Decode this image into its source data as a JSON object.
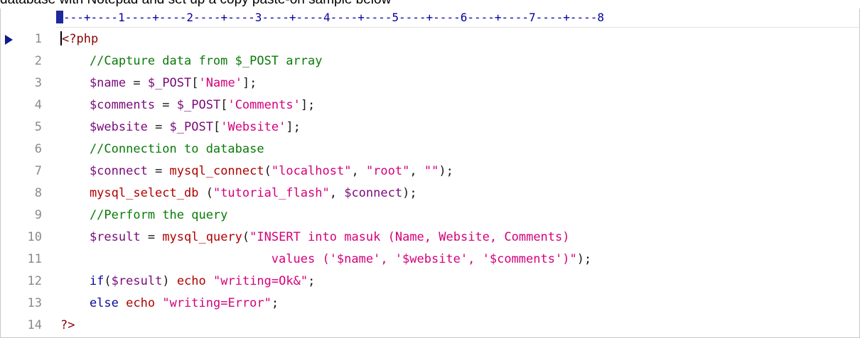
{
  "caption": "database with Notepad and set up a copy paste-on sample below",
  "ruler": "---+----1----+----2----+----3----+----4----+----5----+----6----+----7----+----8",
  "colors": {
    "comment": "#0a7a0a",
    "variable": "#7a0a7a",
    "string": "#d4007a",
    "function": "#b00000",
    "keyword": "#0a0a9a",
    "line_number": "#8a8a8a",
    "ruler": "#0000a0"
  },
  "icons": {
    "current_line": "current-line-arrow-icon"
  },
  "lines": [
    {
      "num": "1",
      "tokens": [
        {
          "t": "<?php",
          "c": "c-tag"
        }
      ]
    },
    {
      "num": "2",
      "tokens": [
        {
          "t": "    //Capture data from $_POST array",
          "c": "c-comment"
        }
      ]
    },
    {
      "num": "3",
      "tokens": [
        {
          "t": "    $name",
          "c": "c-var"
        },
        {
          "t": " = ",
          "c": ""
        },
        {
          "t": "$_POST",
          "c": "c-var"
        },
        {
          "t": "[",
          "c": ""
        },
        {
          "t": "'Name'",
          "c": "c-str"
        },
        {
          "t": "];",
          "c": ""
        }
      ]
    },
    {
      "num": "4",
      "tokens": [
        {
          "t": "    $comments",
          "c": "c-var"
        },
        {
          "t": " = ",
          "c": ""
        },
        {
          "t": "$_POST",
          "c": "c-var"
        },
        {
          "t": "[",
          "c": ""
        },
        {
          "t": "'Comments'",
          "c": "c-str"
        },
        {
          "t": "];",
          "c": ""
        }
      ]
    },
    {
      "num": "5",
      "tokens": [
        {
          "t": "    $website",
          "c": "c-var"
        },
        {
          "t": " = ",
          "c": ""
        },
        {
          "t": "$_POST",
          "c": "c-var"
        },
        {
          "t": "[",
          "c": ""
        },
        {
          "t": "'Website'",
          "c": "c-str"
        },
        {
          "t": "];",
          "c": ""
        }
      ]
    },
    {
      "num": "6",
      "tokens": [
        {
          "t": "    //Connection to database",
          "c": "c-comment"
        }
      ]
    },
    {
      "num": "7",
      "tokens": [
        {
          "t": "    $connect",
          "c": "c-var"
        },
        {
          "t": " = ",
          "c": ""
        },
        {
          "t": "mysql_connect",
          "c": "c-fn"
        },
        {
          "t": "(",
          "c": ""
        },
        {
          "t": "\"localhost\"",
          "c": "c-str"
        },
        {
          "t": ", ",
          "c": ""
        },
        {
          "t": "\"root\"",
          "c": "c-str"
        },
        {
          "t": ", ",
          "c": ""
        },
        {
          "t": "\"\"",
          "c": "c-str"
        },
        {
          "t": ");",
          "c": ""
        }
      ]
    },
    {
      "num": "8",
      "tokens": [
        {
          "t": "    mysql_select_db",
          "c": "c-fn"
        },
        {
          "t": " (",
          "c": ""
        },
        {
          "t": "\"tutorial_flash\"",
          "c": "c-str"
        },
        {
          "t": ", ",
          "c": ""
        },
        {
          "t": "$connect",
          "c": "c-var"
        },
        {
          "t": ");",
          "c": ""
        }
      ]
    },
    {
      "num": "9",
      "tokens": [
        {
          "t": "    //Perform the query",
          "c": "c-comment"
        }
      ]
    },
    {
      "num": "10",
      "tokens": [
        {
          "t": "    $result",
          "c": "c-var"
        },
        {
          "t": " = ",
          "c": ""
        },
        {
          "t": "mysql_query",
          "c": "c-fn"
        },
        {
          "t": "(",
          "c": ""
        },
        {
          "t": "\"INSERT into masuk (Name, Website, Comments)",
          "c": "c-str"
        }
      ]
    },
    {
      "num": "11",
      "tokens": [
        {
          "t": "                             values ('$name', '$website', '$comments')\"",
          "c": "c-str"
        },
        {
          "t": ");",
          "c": ""
        }
      ]
    },
    {
      "num": "12",
      "tokens": [
        {
          "t": "    if",
          "c": "c-kw"
        },
        {
          "t": "(",
          "c": ""
        },
        {
          "t": "$result",
          "c": "c-var"
        },
        {
          "t": ") ",
          "c": ""
        },
        {
          "t": "echo",
          "c": "c-fn"
        },
        {
          "t": " ",
          "c": ""
        },
        {
          "t": "\"writing=Ok&\"",
          "c": "c-str"
        },
        {
          "t": ";",
          "c": ""
        }
      ]
    },
    {
      "num": "13",
      "tokens": [
        {
          "t": "    else",
          "c": "c-kw"
        },
        {
          "t": " ",
          "c": ""
        },
        {
          "t": "echo",
          "c": "c-fn"
        },
        {
          "t": " ",
          "c": ""
        },
        {
          "t": "\"writing=Error\"",
          "c": "c-str"
        },
        {
          "t": ";",
          "c": ""
        }
      ]
    },
    {
      "num": "14",
      "tokens": [
        {
          "t": "?>",
          "c": "c-tag"
        }
      ]
    }
  ]
}
